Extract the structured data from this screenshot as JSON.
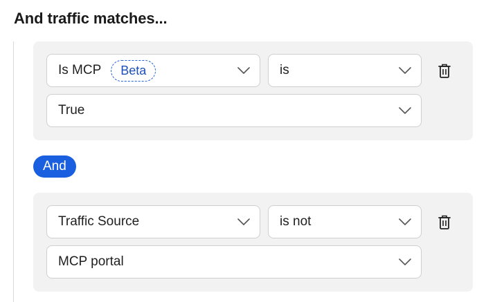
{
  "heading": "And traffic matches...",
  "conditions": [
    {
      "field": "Is MCP",
      "badge": "Beta",
      "operator": "is",
      "value": "True"
    },
    {
      "field": "Traffic Source",
      "operator": "is not",
      "value": "MCP portal"
    }
  ],
  "connector": "And",
  "icons": {
    "dropdown": "chevron-down-icon",
    "delete": "trash-icon"
  },
  "colors": {
    "accent": "#1a5fe0",
    "badge_border": "#2060d8",
    "card_bg": "#f2f2f2"
  }
}
